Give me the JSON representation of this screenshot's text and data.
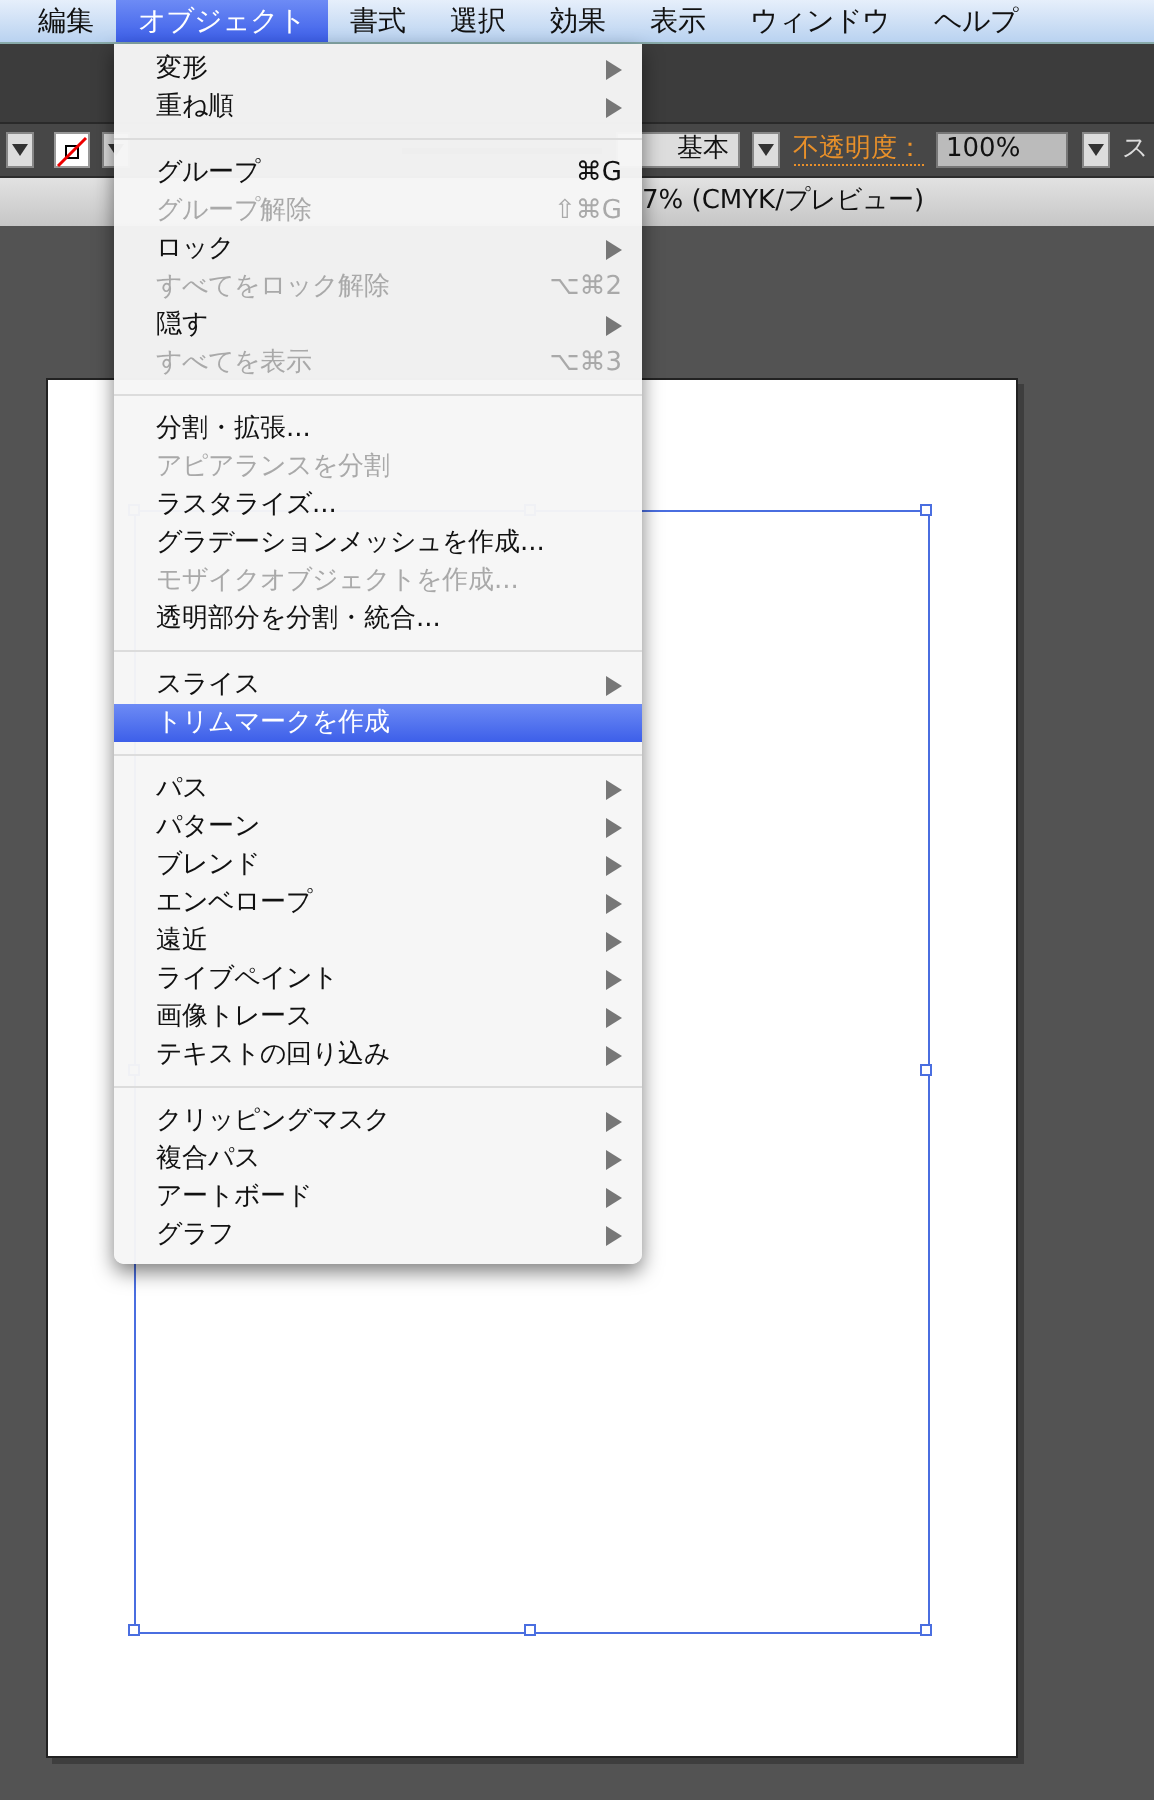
{
  "menubar": [
    {
      "label": "編集",
      "selected": false
    },
    {
      "label": "オブジェクト",
      "selected": true
    },
    {
      "label": "書式",
      "selected": false
    },
    {
      "label": "選択",
      "selected": false
    },
    {
      "label": "効果",
      "selected": false
    },
    {
      "label": "表示",
      "selected": false
    },
    {
      "label": "ウィンドウ",
      "selected": false
    },
    {
      "label": "ヘルプ",
      "selected": false
    }
  ],
  "control_bar": {
    "stroke_profile": "基本",
    "opacity_label": "不透明度：",
    "opacity_value": "100%",
    "cut_label": "ス"
  },
  "document_tab": {
    "title": "7% (CMYK/プレビュー)"
  },
  "menu": [
    {
      "kind": "item",
      "label": "変形",
      "submenu": true,
      "disabled": false,
      "selected": false
    },
    {
      "kind": "item",
      "label": "重ね順",
      "submenu": true,
      "disabled": false,
      "selected": false
    },
    {
      "kind": "separator"
    },
    {
      "kind": "item",
      "label": "グループ",
      "shortcut": "⌘G",
      "submenu": false,
      "disabled": false,
      "selected": false
    },
    {
      "kind": "item",
      "label": "グループ解除",
      "shortcut": "⇧⌘G",
      "submenu": false,
      "disabled": true,
      "selected": false
    },
    {
      "kind": "item",
      "label": "ロック",
      "submenu": true,
      "disabled": false,
      "selected": false
    },
    {
      "kind": "item",
      "label": "すべてをロック解除",
      "shortcut": "⌥⌘2",
      "submenu": false,
      "disabled": true,
      "selected": false
    },
    {
      "kind": "item",
      "label": "隠す",
      "submenu": true,
      "disabled": false,
      "selected": false
    },
    {
      "kind": "item",
      "label": "すべてを表示",
      "shortcut": "⌥⌘3",
      "submenu": false,
      "disabled": true,
      "selected": false
    },
    {
      "kind": "separator"
    },
    {
      "kind": "item",
      "label": "分割・拡張...",
      "submenu": false,
      "disabled": false,
      "selected": false
    },
    {
      "kind": "item",
      "label": "アピアランスを分割",
      "submenu": false,
      "disabled": true,
      "selected": false
    },
    {
      "kind": "item",
      "label": "ラスタライズ...",
      "submenu": false,
      "disabled": false,
      "selected": false
    },
    {
      "kind": "item",
      "label": "グラデーションメッシュを作成...",
      "submenu": false,
      "disabled": false,
      "selected": false
    },
    {
      "kind": "item",
      "label": "モザイクオブジェクトを作成...",
      "submenu": false,
      "disabled": true,
      "selected": false
    },
    {
      "kind": "item",
      "label": "透明部分を分割・統合...",
      "submenu": false,
      "disabled": false,
      "selected": false
    },
    {
      "kind": "separator"
    },
    {
      "kind": "item",
      "label": "スライス",
      "submenu": true,
      "disabled": false,
      "selected": false
    },
    {
      "kind": "item",
      "label": "トリムマークを作成",
      "submenu": false,
      "disabled": false,
      "selected": true
    },
    {
      "kind": "separator"
    },
    {
      "kind": "item",
      "label": "パス",
      "submenu": true,
      "disabled": false,
      "selected": false
    },
    {
      "kind": "item",
      "label": "パターン",
      "submenu": true,
      "disabled": false,
      "selected": false
    },
    {
      "kind": "item",
      "label": "ブレンド",
      "submenu": true,
      "disabled": false,
      "selected": false
    },
    {
      "kind": "item",
      "label": "エンベロープ",
      "submenu": true,
      "disabled": false,
      "selected": false
    },
    {
      "kind": "item",
      "label": "遠近",
      "submenu": true,
      "disabled": false,
      "selected": false
    },
    {
      "kind": "item",
      "label": "ライブペイント",
      "submenu": true,
      "disabled": false,
      "selected": false
    },
    {
      "kind": "item",
      "label": "画像トレース",
      "submenu": true,
      "disabled": false,
      "selected": false
    },
    {
      "kind": "item",
      "label": "テキストの回り込み",
      "submenu": true,
      "disabled": false,
      "selected": false
    },
    {
      "kind": "separator"
    },
    {
      "kind": "item",
      "label": "クリッピングマスク",
      "submenu": true,
      "disabled": false,
      "selected": false
    },
    {
      "kind": "item",
      "label": "複合パス",
      "submenu": true,
      "disabled": false,
      "selected": false
    },
    {
      "kind": "item",
      "label": "アートボード",
      "submenu": true,
      "disabled": false,
      "selected": false
    },
    {
      "kind": "item",
      "label": "グラフ",
      "submenu": true,
      "disabled": false,
      "selected": false
    }
  ]
}
